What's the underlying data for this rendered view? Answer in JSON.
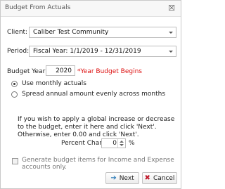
{
  "window": {
    "title": "Budget From Actuals",
    "close_glyph": "☒"
  },
  "form": {
    "client_label": "Client:",
    "client_value": "Caliber Test Community",
    "period_label": "Period:",
    "period_value": "Fiscal Year: 1/1/2019 - 12/31/2019",
    "budget_year_label": "Budget Year:",
    "budget_year_value": "2020",
    "budget_year_note": "*Year Budget Begins",
    "radio_monthly": "Use monthly actuals",
    "radio_spread": "Spread annual amount evenly across months",
    "instructions": "If you wish to apply a global increase or decrease to the budget, enter it here and click 'Next'.  Otherwise, enter 0.00 and click 'Next'.",
    "percent_label": "Percent Change:",
    "percent_value": "0",
    "percent_unit": "%",
    "generate_label": "Generate budget items for Income and Expense accounts only.",
    "selected_option": "monthly"
  },
  "buttons": {
    "next_label": "Next",
    "cancel_label": "Cancel"
  },
  "icons": {
    "close": "close-icon",
    "dropdown": "chevron-down-icon",
    "next": "arrow-right-icon",
    "cancel": "x-icon"
  },
  "colors": {
    "note_red": "#dd1111",
    "next_icon": "#2a7ab8",
    "cancel_icon": "#c0182a"
  }
}
